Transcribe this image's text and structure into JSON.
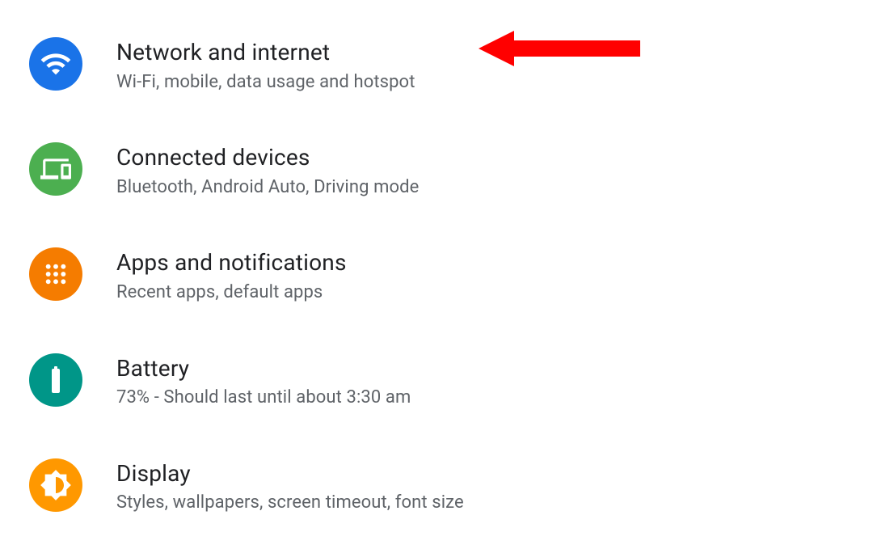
{
  "settings": [
    {
      "title": "Network and internet",
      "subtitle": "Wi-Fi, mobile, data usage and hotspot",
      "icon": "wifi-icon",
      "bg": "#1a73e8"
    },
    {
      "title": "Connected devices",
      "subtitle": "Bluetooth, Android Auto, Driving mode",
      "icon": "devices-icon",
      "bg": "#4caf50"
    },
    {
      "title": "Apps and notifications",
      "subtitle": "Recent apps, default apps",
      "icon": "apps-icon",
      "bg": "#f57c00"
    },
    {
      "title": "Battery",
      "subtitle": "73% - Should last until about 3:30 am",
      "icon": "battery-icon",
      "bg": "#009688"
    },
    {
      "title": "Display",
      "subtitle": "Styles, wallpapers, screen timeout, font size",
      "icon": "display-icon",
      "bg": "#ff9800"
    }
  ],
  "annotation": {
    "type": "arrow",
    "direction": "left",
    "color": "#ff0000"
  }
}
